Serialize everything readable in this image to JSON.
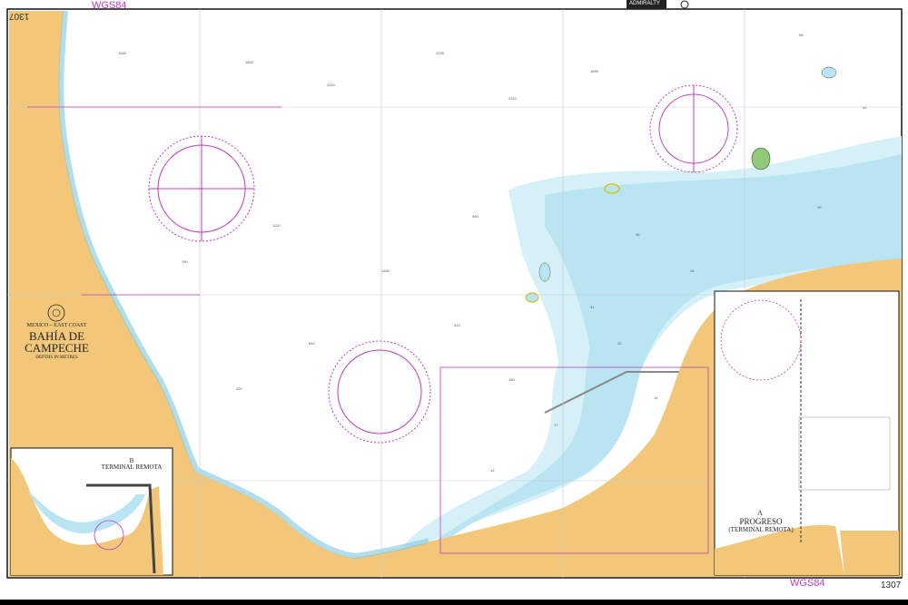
{
  "chart": {
    "number": "1307",
    "datum": "WGS84",
    "region": "MEXICO – EAST COAST",
    "title_line1": "BAHÍA DE",
    "title_line2": "CAMPECHE",
    "depths": "DEPTHS IN METRES",
    "publisher_badge": "ADMIRALTY"
  },
  "insets": {
    "terminal_remota": {
      "marker": "B",
      "title": "TERMINAL REMOTA"
    },
    "progreso": {
      "marker": "A",
      "title_line1": "PROGRESO",
      "title_line2": "(TERMINAL REMOTA)"
    }
  },
  "colors": {
    "land": "#f2c77a",
    "shallow": "#b9e4f2",
    "mid_shallow": "#d6f0f8",
    "sea": "#ffffff",
    "drying": "#8fc97a",
    "magenta": "#c03cc0",
    "border": "#111111"
  },
  "icons": [
    "compass-rose-icon",
    "anchorage-icon",
    "seal-icon"
  ]
}
